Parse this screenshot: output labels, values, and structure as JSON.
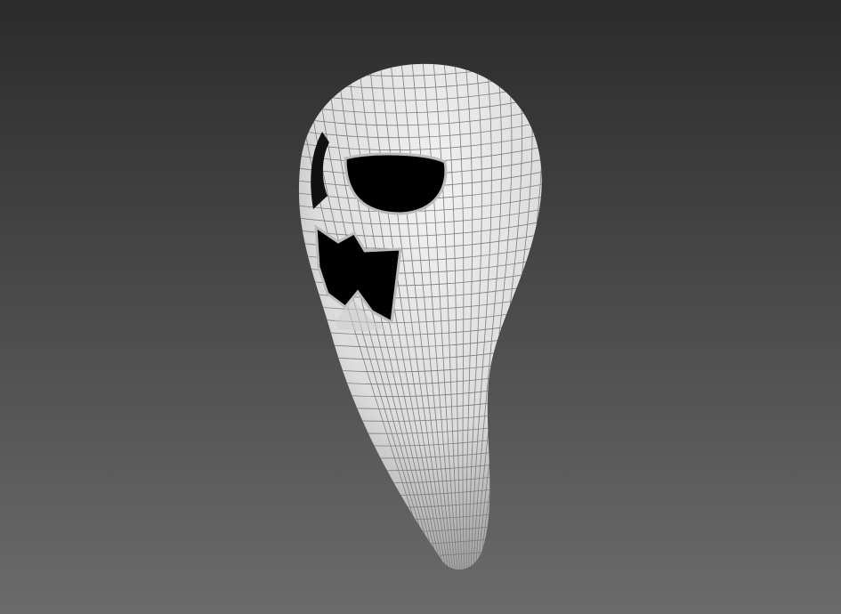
{
  "viewport": {
    "background_top": "#2b2b2b",
    "background_bottom": "#6b6b6b",
    "mesh_color": "#e6e6e6",
    "mesh_shadow": "#9a9a9a",
    "wire_color": "#7d7d7d",
    "hole_color": "#000000"
  }
}
